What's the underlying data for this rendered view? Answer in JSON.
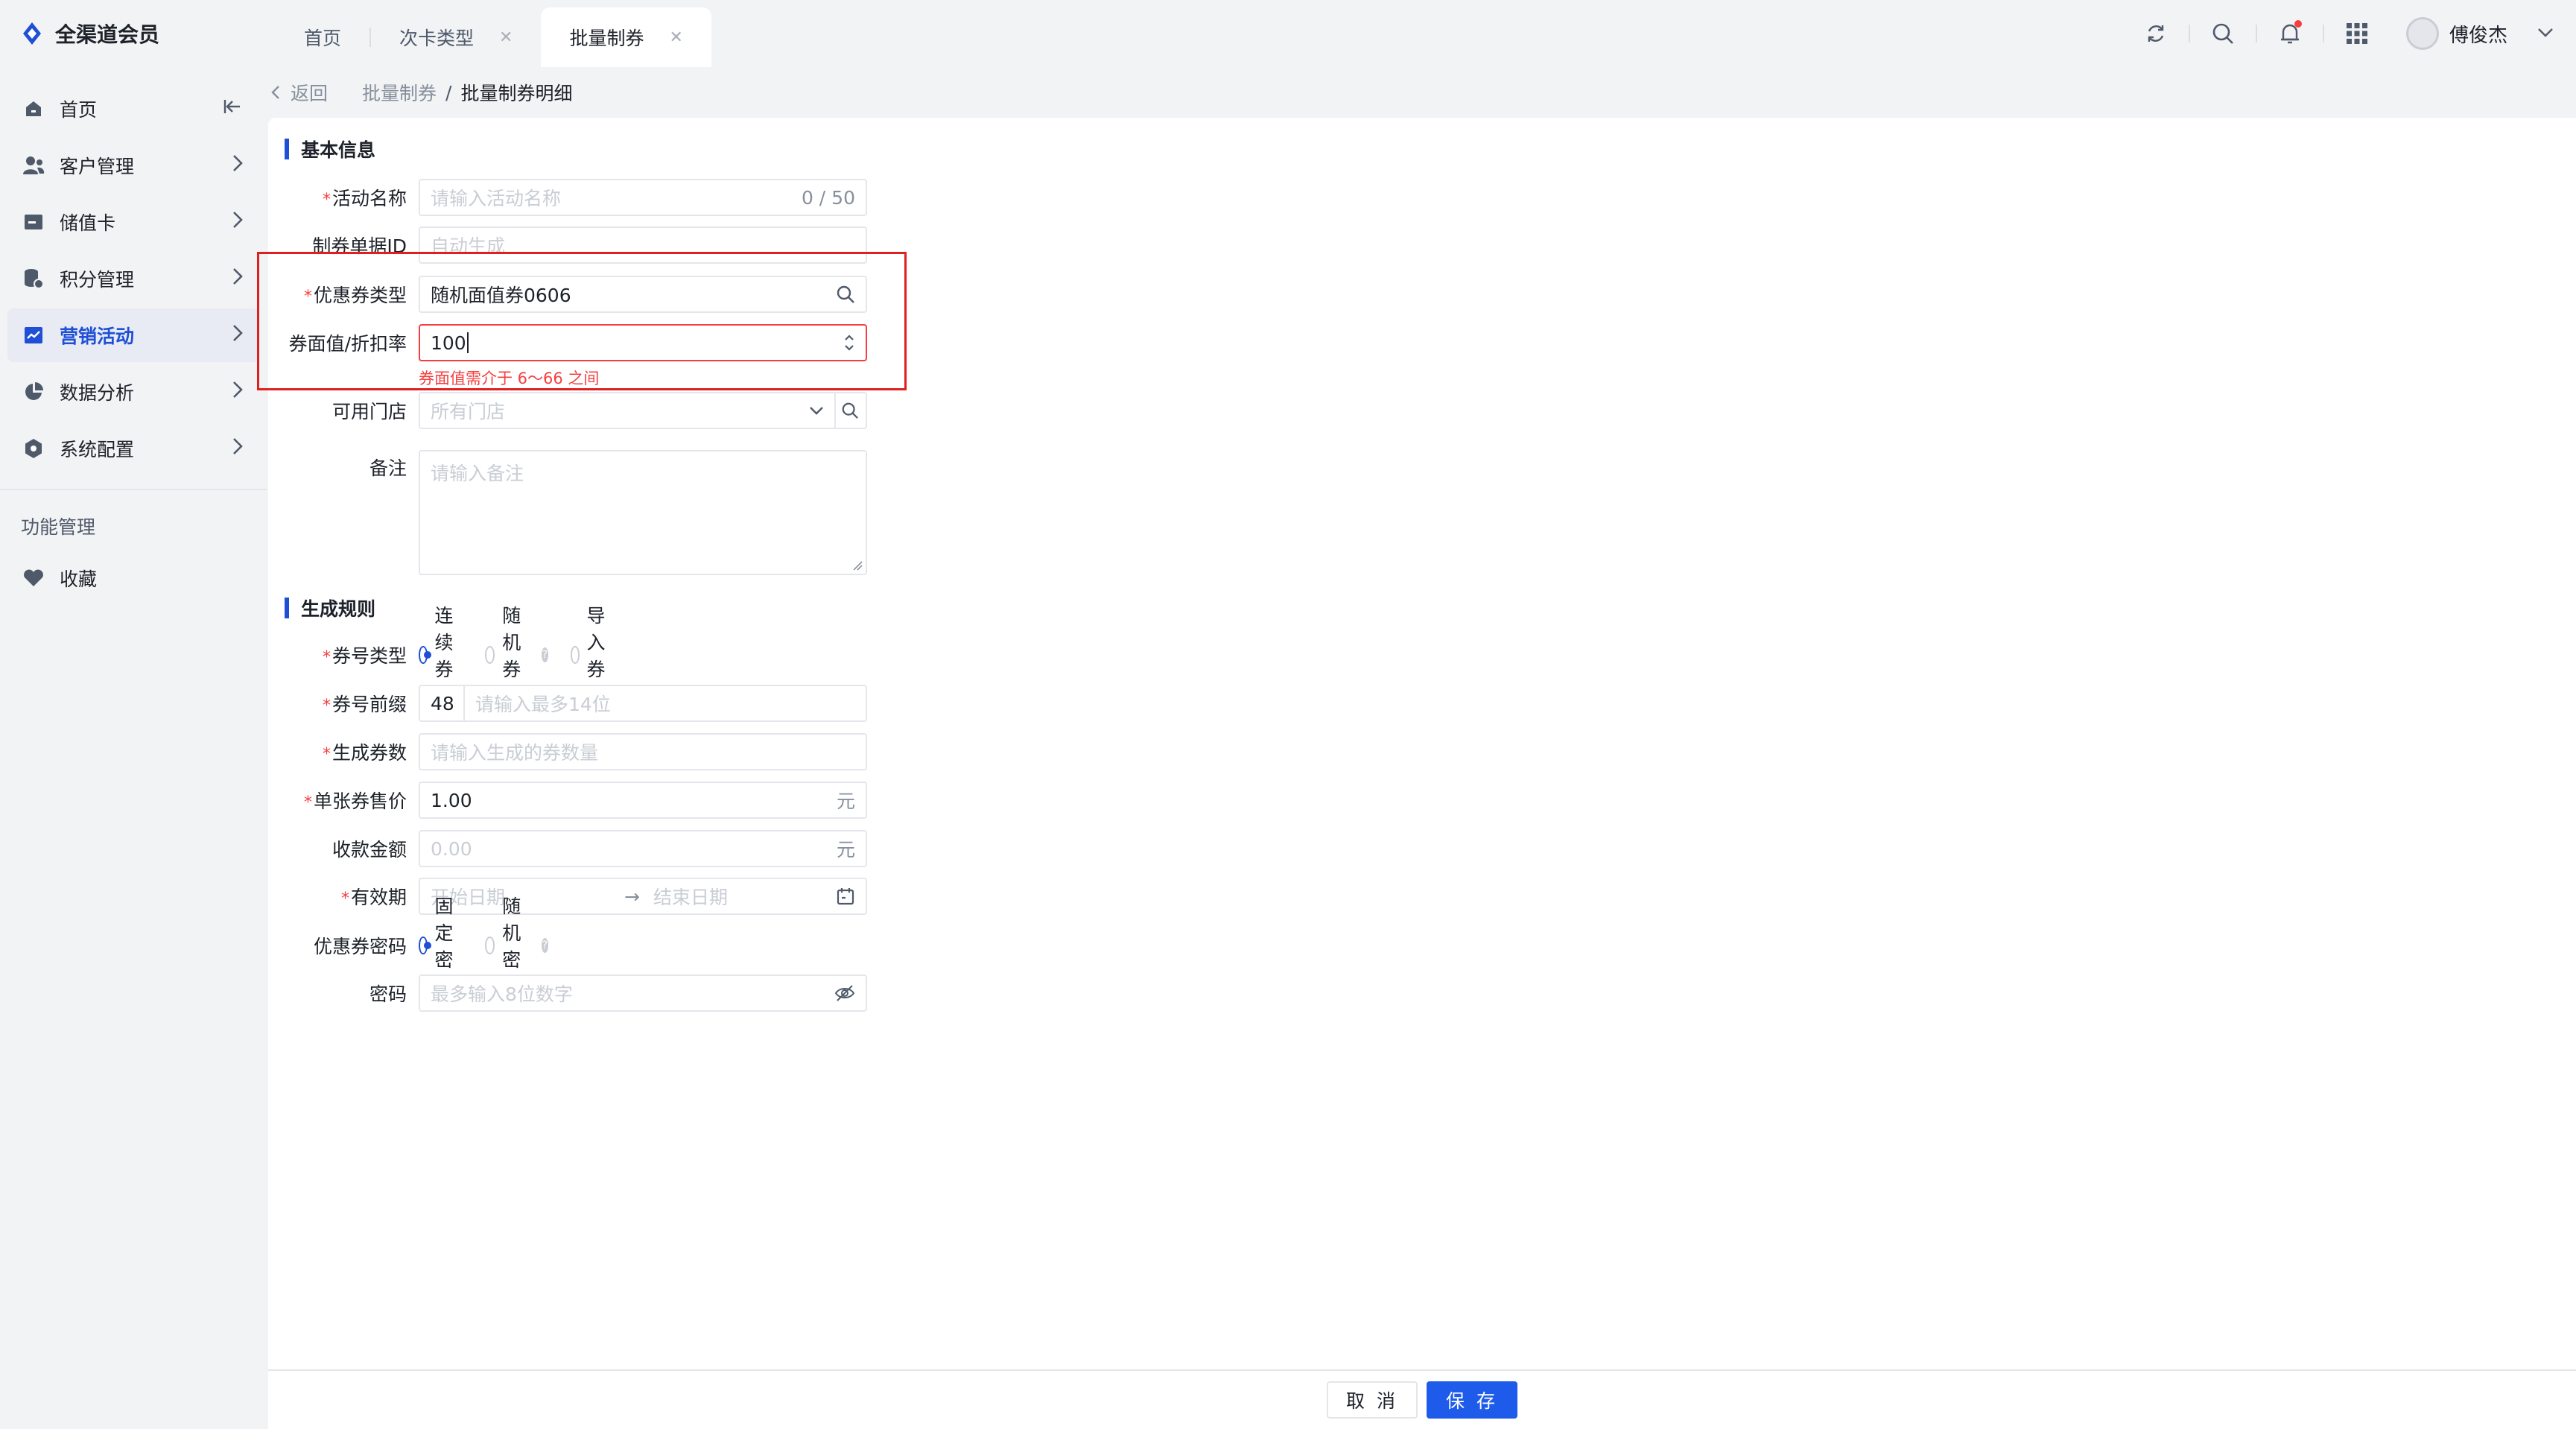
{
  "app": {
    "name": "全渠道会员"
  },
  "tabs": [
    {
      "label": "首页",
      "closable": false,
      "active": false
    },
    {
      "label": "次卡类型",
      "closable": true,
      "active": false
    },
    {
      "label": "批量制券",
      "closable": true,
      "active": true
    }
  ],
  "user": {
    "name": "傅俊杰"
  },
  "sidebar": {
    "items": [
      {
        "label": "首页",
        "icon": "home-icon",
        "active": false
      },
      {
        "label": "客户管理",
        "icon": "user-icon",
        "active": false
      },
      {
        "label": "储值卡",
        "icon": "card-icon",
        "active": false
      },
      {
        "label": "积分管理",
        "icon": "coins-icon",
        "active": false
      },
      {
        "label": "营销活动",
        "icon": "chart-icon",
        "active": true
      },
      {
        "label": "数据分析",
        "icon": "pie-icon",
        "active": false
      },
      {
        "label": "系统配置",
        "icon": "settings-icon",
        "active": false
      }
    ],
    "section_title": "功能管理",
    "favorites": {
      "label": "收藏",
      "icon": "heart-icon"
    }
  },
  "breadcrumb": {
    "back": "返回",
    "parent": "批量制券",
    "sep": "/",
    "current": "批量制券明细"
  },
  "basic": {
    "title": "基本信息",
    "activity_name": {
      "label": "活动名称",
      "placeholder": "请输入活动名称",
      "counter": "0 / 50"
    },
    "doc_id": {
      "label": "制券单据ID",
      "placeholder": "自动生成"
    },
    "coupon_type": {
      "label": "优惠券类型",
      "value": "随机面值券0606"
    },
    "face_value": {
      "label": "券面值/折扣率",
      "value": "100",
      "error": "券面值需介于 6～66 之间"
    },
    "stores": {
      "label": "可用门店",
      "placeholder": "所有门店"
    },
    "remark": {
      "label": "备注",
      "placeholder": "请输入备注"
    }
  },
  "rules": {
    "title": "生成规则",
    "number_type": {
      "label": "券号类型",
      "options": [
        "连续券号",
        "随机券号",
        "导入券号"
      ],
      "selected": 0
    },
    "prefix": {
      "label": "券号前缀",
      "value": "48",
      "placeholder": "请输入最多14位"
    },
    "count": {
      "label": "生成券数",
      "placeholder": "请输入生成的券数量"
    },
    "unit_price": {
      "label": "单张券售价",
      "value": "1.00",
      "unit": "元"
    },
    "amount": {
      "label": "收款金额",
      "placeholder": "0.00",
      "unit": "元"
    },
    "validity": {
      "label": "有效期",
      "start_placeholder": "开始日期",
      "end_placeholder": "结束日期"
    },
    "password_mode": {
      "label": "优惠券密码",
      "options": [
        "固定密码",
        "随机密码"
      ],
      "selected": 0
    },
    "password": {
      "label": "密码",
      "placeholder": "最多输入8位数字"
    }
  },
  "footer": {
    "cancel": "取 消",
    "save": "保 存"
  },
  "colors": {
    "primary": "#1e4fd6",
    "error": "#f53f3f",
    "highlight": "#e02020"
  }
}
